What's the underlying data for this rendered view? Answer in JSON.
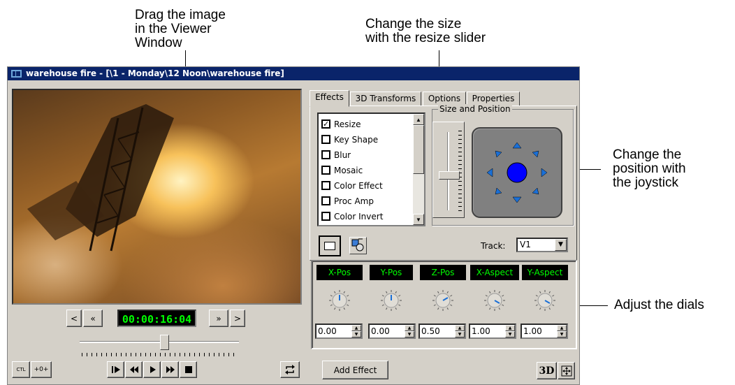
{
  "callouts": {
    "drag_image": "Drag the image\nin the Viewer\nWindow",
    "resize_slider": "Change the size\nwith the resize slider",
    "joystick": "Change the\nposition with\nthe joystick",
    "dials": "Adjust the dials"
  },
  "window": {
    "title": "warehouse fire - [\\1 - Monday\\12 Noon\\warehouse fire]"
  },
  "transport": {
    "timecode": "00:00:16:04",
    "prev_frame": "<",
    "rewind_fast": "«",
    "forward_fast": "»",
    "next_frame": ">",
    "ctl_label": "CTL",
    "zero_label": "+0+",
    "position_fraction": 0.53
  },
  "tabs": [
    {
      "label": "Effects",
      "active": true
    },
    {
      "label": "3D Transforms",
      "active": false
    },
    {
      "label": "Options",
      "active": false
    },
    {
      "label": "Properties",
      "active": false
    }
  ],
  "effects": [
    {
      "label": "Resize",
      "checked": true
    },
    {
      "label": "Key Shape",
      "checked": false
    },
    {
      "label": "Blur",
      "checked": false
    },
    {
      "label": "Mosaic",
      "checked": false
    },
    {
      "label": "Color Effect",
      "checked": false
    },
    {
      "label": "Proc Amp",
      "checked": false
    },
    {
      "label": "Color Invert",
      "checked": false
    }
  ],
  "size_position": {
    "group_label": "Size and Position",
    "resize_level": 0.45
  },
  "track": {
    "label": "Track:",
    "value": "V1"
  },
  "params": [
    {
      "label": "X-Pos",
      "value": "0.00"
    },
    {
      "label": "Y-Pos",
      "value": "0.00"
    },
    {
      "label": "Z-Pos",
      "value": "0.50"
    },
    {
      "label": "X-Aspect",
      "value": "1.00"
    },
    {
      "label": "Y-Aspect",
      "value": "1.00"
    }
  ],
  "buttons": {
    "add_effect": "Add Effect",
    "three_d": "3D"
  },
  "colors": {
    "title_bar": "#0a246a",
    "timecode_text": "#00ff00",
    "joystick_dot": "#0000ff",
    "panel_bg": "#d4d0c8"
  }
}
